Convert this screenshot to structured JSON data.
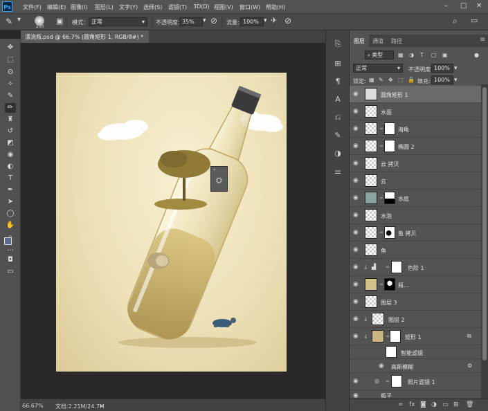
{
  "app": {
    "logo": "Ps"
  },
  "menu": [
    "文件(F)",
    "编辑(E)",
    "图像(I)",
    "图层(L)",
    "文字(Y)",
    "选择(S)",
    "滤镜(T)",
    "3D(D)",
    "视图(V)",
    "窗口(W)",
    "帮助(H)"
  ],
  "options": {
    "brush_size": "200",
    "mode_label": "模式：",
    "mode_value": "正常",
    "opacity_label": "不透明度:",
    "opacity_value": "35%",
    "flow_label": "流量:",
    "flow_value": "100%"
  },
  "document": {
    "tab_title": "漂流瓶.psd @ 66.7% (圆角矩形 1, RGB/8#) *",
    "zoom": "66.67%",
    "doc_size": "文档:2.21M/24.7M"
  },
  "panels": {
    "tabs": [
      "图层",
      "通道",
      "路径"
    ],
    "filter_kind": "类型",
    "blend_mode": "正常",
    "opacity_label": "不透明度:",
    "opacity_value": "100%",
    "lock_label": "锁定:",
    "fill_label": "填充:",
    "fill_value": "100%"
  },
  "layers": [
    {
      "name": "圆角矩形 1",
      "selected": true
    },
    {
      "name": "水面"
    },
    {
      "name": "海龟"
    },
    {
      "name": "椭圆 2"
    },
    {
      "name": "云 拷贝"
    },
    {
      "name": "云"
    },
    {
      "name": "水底"
    },
    {
      "name": "水泡"
    },
    {
      "name": "鱼 拷贝"
    },
    {
      "name": "鱼"
    },
    {
      "name": "色阶 1"
    },
    {
      "name": "瓶..."
    },
    {
      "name": "图层 3"
    },
    {
      "name": "图层 2"
    },
    {
      "name": "矩形 1"
    },
    {
      "name": "智能滤镜"
    },
    {
      "name": "高斯模糊"
    },
    {
      "name": "照片滤镜 1"
    },
    {
      "name": "瓶子"
    }
  ],
  "colors": {
    "ps_blue": "#31a8ff",
    "panel_bg": "#535353",
    "selected_row": "#6a6a6a",
    "canvas_bg": "#ece0b6"
  }
}
